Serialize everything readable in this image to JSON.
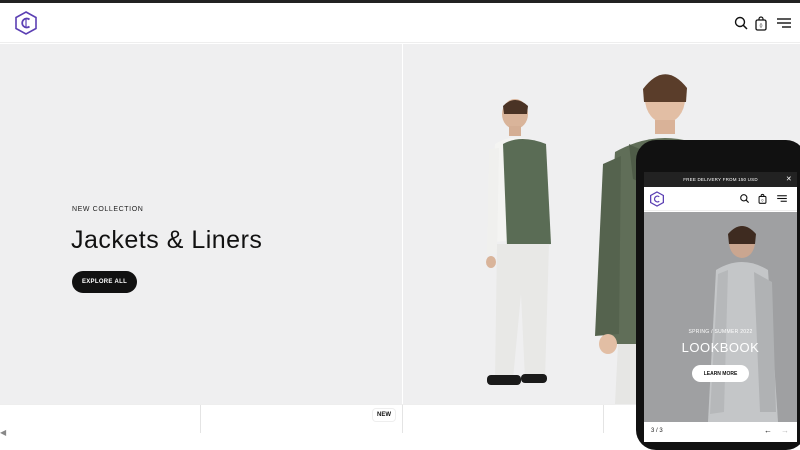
{
  "header": {
    "logo_icon": "cube-logo-icon",
    "icons": [
      "search-icon",
      "shopping-bag-icon",
      "menu-icon"
    ],
    "cart_count": "0"
  },
  "hero": {
    "eyebrow": "NEW COLLECTION",
    "title": "Jackets & Liners",
    "cta_label": "EXPLORE ALL"
  },
  "strip": {
    "badge": "NEW"
  },
  "phone": {
    "announcement": "FREE DELIVERY FROM 150 USD",
    "close_label": "✕",
    "cart_count": "0",
    "hero": {
      "eyebrow": "SPRING / SUMMER 2022",
      "title": "LOOKBOOK",
      "cta_label": "LEARN MORE"
    },
    "slide_counter": "3 / 3",
    "prev_label": "←",
    "next_label": "→"
  },
  "colors": {
    "accent": "#5b3fb3",
    "background": "#efeff0",
    "dark": "#111111"
  }
}
